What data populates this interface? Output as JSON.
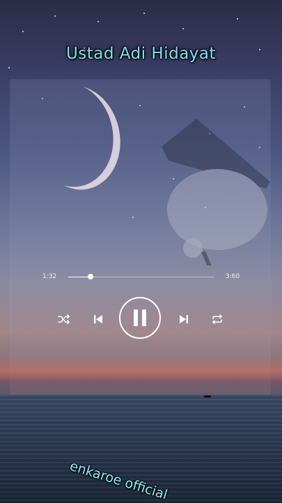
{
  "header": {
    "title": "Ustad Adi Hidayat"
  },
  "player": {
    "elapsed": "1:32",
    "total": "3:60",
    "progress_fraction": 0.15,
    "is_playing": true,
    "controls": {
      "shuffle_icon": "shuffle-icon",
      "previous_icon": "skip-previous-icon",
      "pause_icon": "pause-icon",
      "next_icon": "skip-next-icon",
      "repeat_icon": "repeat-icon"
    }
  },
  "watermark": {
    "text": "enkaroe official"
  },
  "colors": {
    "title": "#7fe0f2",
    "watermark": "#8fe9f6",
    "controls": "#ffffff"
  }
}
